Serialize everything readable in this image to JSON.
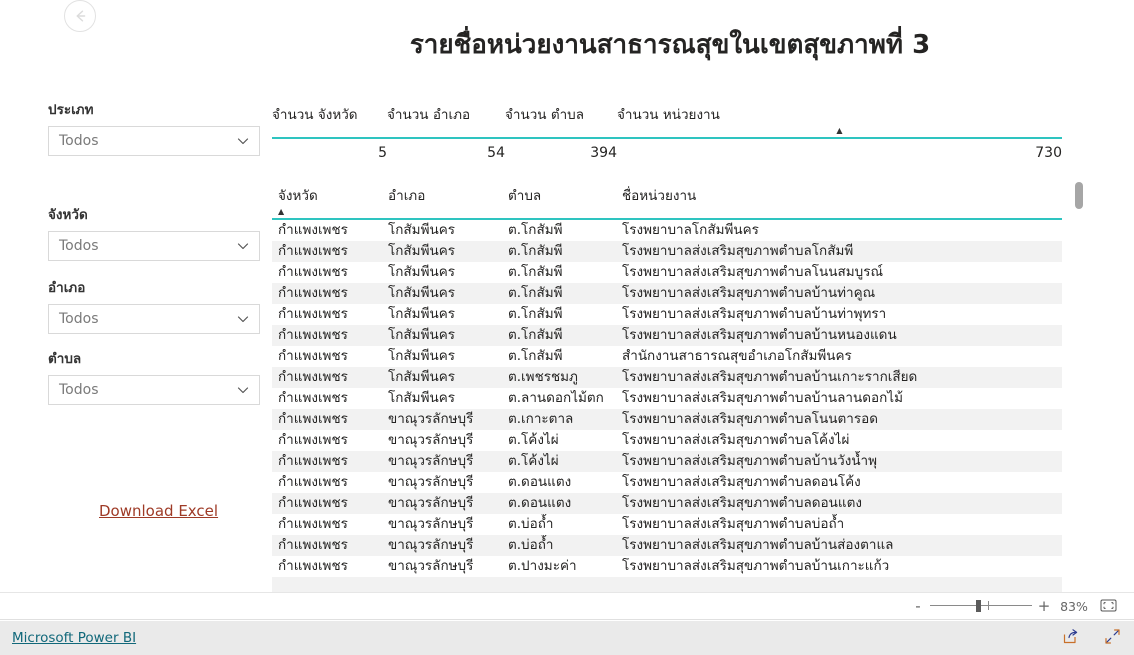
{
  "report": {
    "title": "รายชื่อหน่วยงานสาธารณสุขในเขตสุขภาพที่ 3",
    "back_icon": "back-arrow-icon"
  },
  "filters": [
    {
      "label": "ประเภท",
      "value": "Todos",
      "icon": "chevron-down-icon"
    },
    {
      "label": "จังหวัด",
      "value": "Todos",
      "icon": "chevron-down-icon"
    },
    {
      "label": "อำเภอ",
      "value": "Todos",
      "icon": "chevron-down-icon"
    },
    {
      "label": "ตำบล",
      "value": "Todos",
      "icon": "chevron-down-icon"
    }
  ],
  "download": {
    "label": "Download Excel"
  },
  "summary": {
    "headers": [
      {
        "label": "จำนวน จังหวัด",
        "sorted": false,
        "caret": ""
      },
      {
        "label": "จำนวน อำเภอ",
        "sorted": false,
        "caret": ""
      },
      {
        "label": "จำนวน ตำบล",
        "sorted": false,
        "caret": ""
      },
      {
        "label": "จำนวน หน่วยงาน",
        "sorted": true,
        "caret": "▲"
      }
    ],
    "values": [
      "5",
      "54",
      "394",
      "730"
    ]
  },
  "table": {
    "headers": [
      {
        "label": "จังหวัด",
        "sorted": true,
        "caret": "▲"
      },
      {
        "label": "อำเภอ",
        "sorted": false,
        "caret": ""
      },
      {
        "label": "ตำบล",
        "sorted": false,
        "caret": ""
      },
      {
        "label": "ชื่อหน่วยงาน",
        "sorted": false,
        "caret": ""
      }
    ],
    "rows": [
      [
        "กำแพงเพชร",
        "โกสัมพีนคร",
        "ต.โกสัมพี",
        "โรงพยาบาลโกสัมพีนคร"
      ],
      [
        "กำแพงเพชร",
        "โกสัมพีนคร",
        "ต.โกสัมพี",
        "โรงพยาบาลส่งเสริมสุขภาพตำบลโกสัมพี"
      ],
      [
        "กำแพงเพชร",
        "โกสัมพีนคร",
        "ต.โกสัมพี",
        "โรงพยาบาลส่งเสริมสุขภาพตำบลโนนสมบูรณ์"
      ],
      [
        "กำแพงเพชร",
        "โกสัมพีนคร",
        "ต.โกสัมพี",
        "โรงพยาบาลส่งเสริมสุขภาพตำบลบ้านท่าคูณ"
      ],
      [
        "กำแพงเพชร",
        "โกสัมพีนคร",
        "ต.โกสัมพี",
        "โรงพยาบาลส่งเสริมสุขภาพตำบลบ้านท่าพุทรา"
      ],
      [
        "กำแพงเพชร",
        "โกสัมพีนคร",
        "ต.โกสัมพี",
        "โรงพยาบาลส่งเสริมสุขภาพตำบลบ้านหนองแดน"
      ],
      [
        "กำแพงเพชร",
        "โกสัมพีนคร",
        "ต.โกสัมพี",
        "สำนักงานสาธารณสุขอำเภอโกสัมพีนคร"
      ],
      [
        "กำแพงเพชร",
        "โกสัมพีนคร",
        "ต.เพชรชมภู",
        "โรงพยาบาลส่งเสริมสุขภาพตำบลบ้านเกาะรากเสียด"
      ],
      [
        "กำแพงเพชร",
        "โกสัมพีนคร",
        "ต.ลานดอกไม้ตก",
        "โรงพยาบาลส่งเสริมสุขภาพตำบลบ้านลานดอกไม้"
      ],
      [
        "กำแพงเพชร",
        "ขาณุวรลักษบุรี",
        "ต.เกาะตาล",
        "โรงพยาบาลส่งเสริมสุขภาพตำบลโนนตารอด"
      ],
      [
        "กำแพงเพชร",
        "ขาณุวรลักษบุรี",
        "ต.โค้งไผ่",
        "โรงพยาบาลส่งเสริมสุขภาพตำบลโค้งไผ่"
      ],
      [
        "กำแพงเพชร",
        "ขาณุวรลักษบุรี",
        "ต.โค้งไผ่",
        "โรงพยาบาลส่งเสริมสุขภาพตำบลบ้านวังน้ำพุ"
      ],
      [
        "กำแพงเพชร",
        "ขาณุวรลักษบุรี",
        "ต.ดอนแตง",
        "โรงพยาบาลส่งเสริมสุขภาพตำบลดอนโค้ง"
      ],
      [
        "กำแพงเพชร",
        "ขาณุวรลักษบุรี",
        "ต.ดอนแตง",
        "โรงพยาบาลส่งเสริมสุขภาพตำบลดอนแตง"
      ],
      [
        "กำแพงเพชร",
        "ขาณุวรลักษบุรี",
        "ต.บ่อถ้ำ",
        "โรงพยาบาลส่งเสริมสุขภาพตำบลบ่อถ้ำ"
      ],
      [
        "กำแพงเพชร",
        "ขาณุวรลักษบุรี",
        "ต.บ่อถ้ำ",
        "โรงพยาบาลส่งเสริมสุขภาพตำบลบ้านส่องตาแล"
      ],
      [
        "กำแพงเพชร",
        "ขาณุวรลักษบุรี",
        "ต.ปางมะค่า",
        "โรงพยาบาลส่งเสริมสุขภาพตำบลบ้านเกาะแก้ว"
      ]
    ]
  },
  "statusbar": {
    "zoom_out_label": "-",
    "zoom_in_label": "+",
    "zoom_percent": "83%",
    "fit_icon": "fit-to-page-icon"
  },
  "footer": {
    "brand": "Microsoft Power BI",
    "share_icon": "share-icon",
    "fullscreen_icon": "fullscreen-icon"
  },
  "colors": {
    "accent_teal": "#2ec4c0",
    "link_red": "#9e3a26",
    "brand_teal": "#11687a",
    "row_alt": "#f2f2f2"
  }
}
